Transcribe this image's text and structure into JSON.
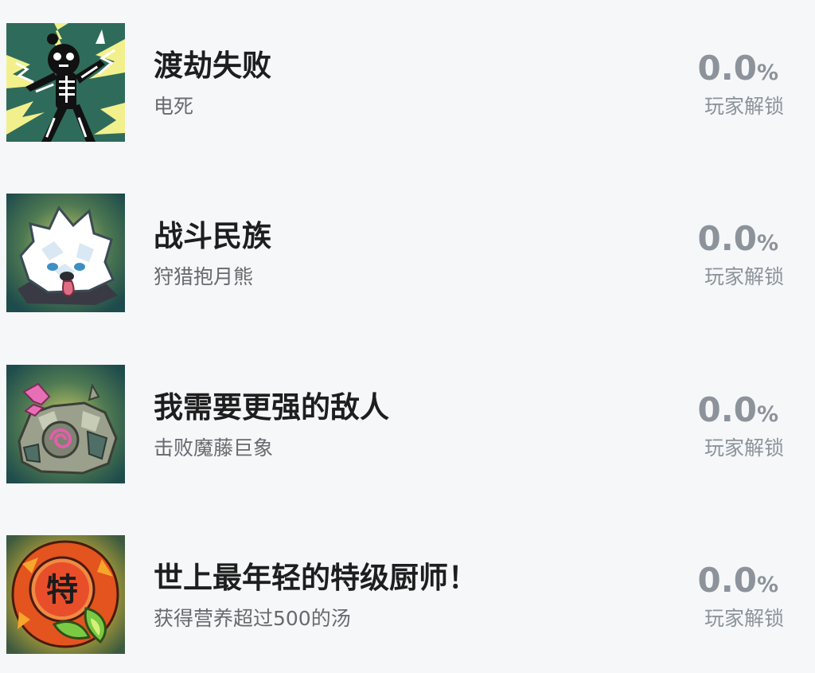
{
  "achievements": [
    {
      "icon": "electrocuted-skeleton-icon",
      "title": "渡劫失败",
      "description": "电死",
      "rate_value": "0.0",
      "rate_unit": "%",
      "rate_label": "玩家解锁"
    },
    {
      "icon": "moon-bear-icon",
      "title": "战斗民族",
      "description": "狩猎抱月熊",
      "rate_value": "0.0",
      "rate_unit": "%",
      "rate_label": "玩家解锁"
    },
    {
      "icon": "vine-golem-icon",
      "title": "我需要更强的敌人",
      "description": "击败魔藤巨象",
      "rate_value": "0.0",
      "rate_unit": "%",
      "rate_label": "玩家解锁"
    },
    {
      "icon": "special-chef-badge-icon",
      "title": "世上最年轻的特级厨师！",
      "description": "获得营养超过500的汤",
      "rate_value": "0.0",
      "rate_unit": "%",
      "rate_label": "玩家解锁",
      "badge_char": "特"
    }
  ]
}
